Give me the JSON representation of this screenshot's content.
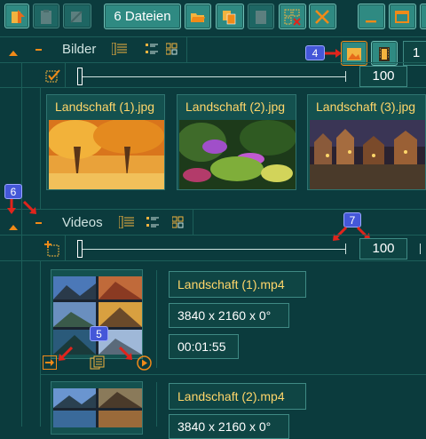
{
  "toolbar": {
    "files_count_label": "6 Dateien"
  },
  "sections": [
    {
      "title": "Bilder",
      "zoom_value": "100",
      "extra_value": "1"
    },
    {
      "title": "Videos",
      "zoom_value": "100"
    }
  ],
  "images": [
    {
      "label": "Landschaft (1).jpg"
    },
    {
      "label": "Landschaft (2).jpg"
    },
    {
      "label": "Landschaft (3).jpg"
    }
  ],
  "videos": [
    {
      "name": "Landschaft (1).mp4",
      "resolution": "3840 x 2160 x 0°",
      "duration": "00:01:55"
    },
    {
      "name": "Landschaft (2).mp4",
      "resolution": "3840 x 2160 x 0°"
    }
  ],
  "markers": [
    "4",
    "5",
    "6",
    "7"
  ],
  "icons": {
    "collapse": "triangle-up-icon",
    "minus": "minus-icon",
    "list_view": "list-view-icon",
    "detail_view": "detail-view-icon",
    "grid_view": "grid-view-icon"
  },
  "colors": {
    "background": "#0b3b3d",
    "button": "#2f8a82",
    "label_gold": "#ffd66a",
    "marker": "#4457d8",
    "arrow_red": "#e0241c",
    "accent_orange": "#f08a18"
  }
}
